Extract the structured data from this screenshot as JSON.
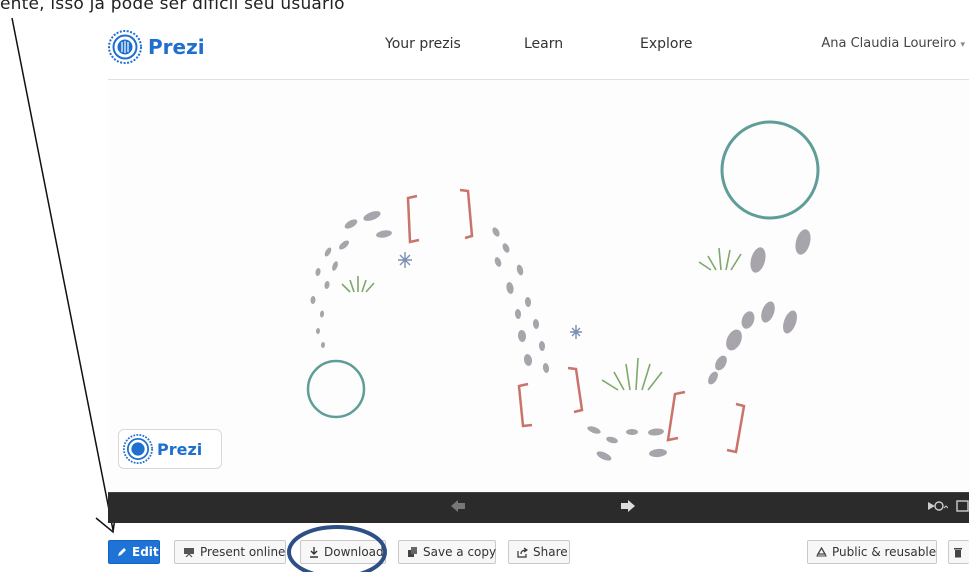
{
  "annotation": {
    "fragment": "ente, isso já pode ser  difícil seu usuário"
  },
  "header": {
    "brand": "Prezi",
    "nav": [
      {
        "label": "Your prezis"
      },
      {
        "label": "Learn"
      },
      {
        "label": "Explore"
      }
    ],
    "user_name": "Ana Claudia Loureiro"
  },
  "canvas": {
    "logo_text": "Prezi"
  },
  "toolbar": {
    "edit": "Edit",
    "present_online": "Present online",
    "download": "Download",
    "save_copy": "Save a copy",
    "share": "Share",
    "public": "Public & reusable"
  },
  "colors": {
    "brand_blue": "#1f6fcf",
    "edit_blue": "#1e73d7",
    "annotation_ellipse": "#2d4f86",
    "frame_circle": "#5f9e98",
    "bracket": "#c9736a",
    "footprint": "#a7a4ab",
    "playbar": "#2b2b2b"
  }
}
